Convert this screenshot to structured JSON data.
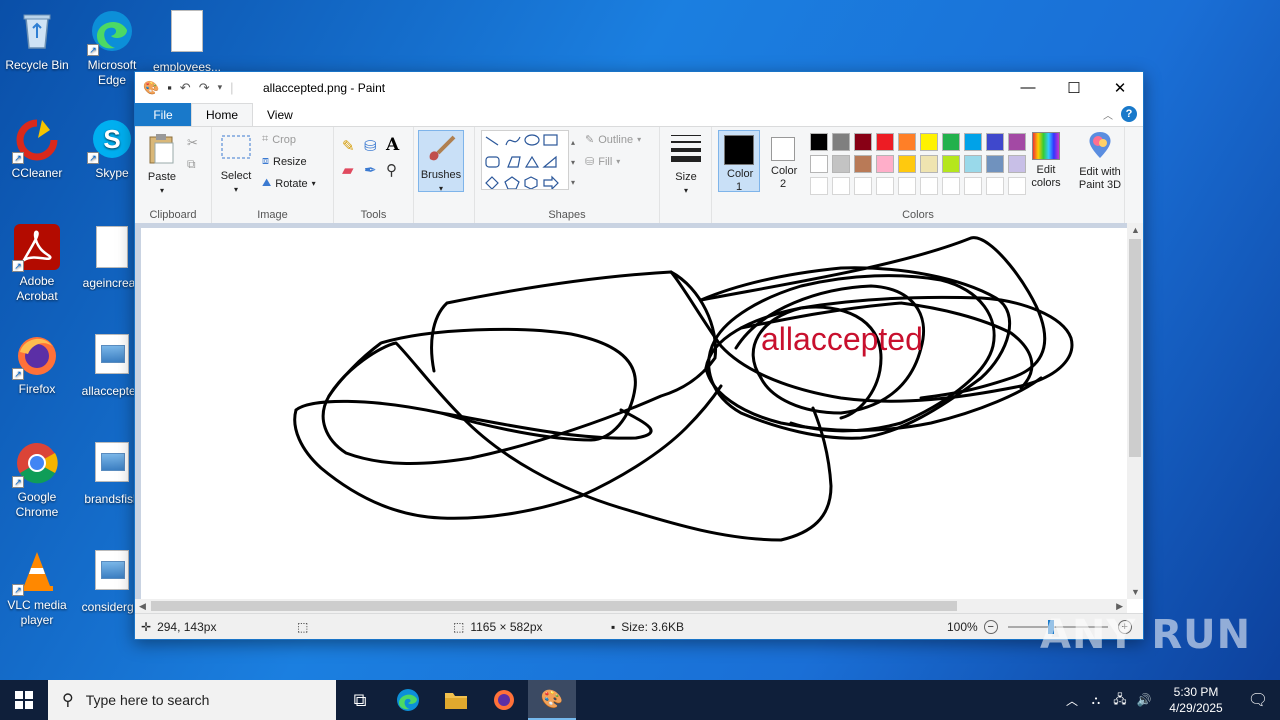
{
  "desktop": {
    "icons": [
      {
        "label": "Recycle Bin"
      },
      {
        "label": "Microsoft Edge"
      },
      {
        "label": "employees..."
      },
      {
        "label": "CCleaner"
      },
      {
        "label": "Skype"
      },
      {
        "label": "Adobe Acrobat"
      },
      {
        "label": "ageincreas"
      },
      {
        "label": "Firefox"
      },
      {
        "label": "allaccepted"
      },
      {
        "label": "Google Chrome"
      },
      {
        "label": "brandsfish"
      },
      {
        "label": "VLC media player"
      },
      {
        "label": "considergiv"
      }
    ]
  },
  "window": {
    "title": "allaccepted.png - Paint",
    "tabs": [
      "File",
      "Home",
      "View"
    ]
  },
  "ribbon": {
    "clipboard": {
      "paste": "Paste",
      "group": "Clipboard"
    },
    "image": {
      "select": "Select",
      "crop": "Crop",
      "resize": "Resize",
      "rotate": "Rotate",
      "group": "Image"
    },
    "tools": {
      "group": "Tools"
    },
    "brushes": {
      "label": "Brushes"
    },
    "shapes": {
      "outline": "Outline",
      "fill": "Fill",
      "group": "Shapes"
    },
    "size": {
      "label": "Size"
    },
    "colors": {
      "color1": "Color 1",
      "color2": "Color 2",
      "edit": "Edit colors",
      "paint3d": "Edit with Paint 3D",
      "group": "Colors",
      "color1_value": "#000000",
      "color2_value": "#ffffff",
      "palette_row1": [
        "#000000",
        "#7f7f7f",
        "#880015",
        "#ed1c24",
        "#ff7f27",
        "#fff200",
        "#22b14c",
        "#00a2e8",
        "#3f48cc",
        "#a349a4"
      ],
      "palette_row2": [
        "#ffffff",
        "#c3c3c3",
        "#b97a57",
        "#ffaec9",
        "#ffc90e",
        "#efe4b0",
        "#b5e61d",
        "#99d9ea",
        "#7092be",
        "#c8bfe7"
      ]
    }
  },
  "canvas": {
    "text": "allaccepted",
    "text_color": "#c8102e"
  },
  "status": {
    "cursor": "294, 143px",
    "image_size": "1165 × 582px",
    "file_size": "Size: 3.6KB",
    "zoom": "100%"
  },
  "taskbar": {
    "search_placeholder": "Type here to search",
    "time": "5:30 PM",
    "date": "4/29/2025"
  },
  "watermark": "ANY RUN"
}
